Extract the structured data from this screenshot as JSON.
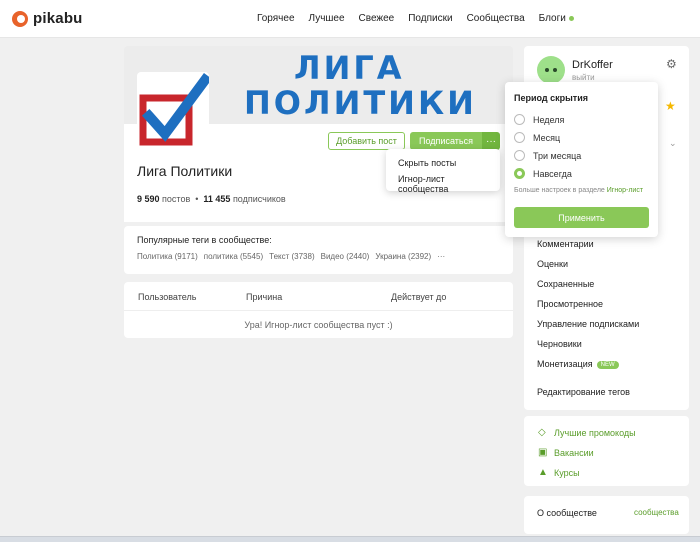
{
  "header": {
    "brand": "pikabu",
    "nav": [
      "Горячее",
      "Лучшее",
      "Свежее",
      "Подписки",
      "Сообщества",
      "Блоги"
    ]
  },
  "banner": {
    "line1": "ЛИГА",
    "line2": "ПОЛИТИКИ"
  },
  "community": {
    "title": "Лига Политики",
    "posts_count": "9 590",
    "posts_label": "постов",
    "subs_count": "11 455",
    "subs_label": "подписчиков",
    "add_post": "Добавить пост",
    "subscribe": "Подписаться",
    "more": "···"
  },
  "dropdown": {
    "items": [
      "Скрыть посты",
      "Игнор-лист сообщества"
    ]
  },
  "tags": {
    "title": "Популярные теги в сообществе:",
    "items": [
      "Политика (9171)",
      "политика (5545)",
      "Текст (3738)",
      "Видео (2440)",
      "Украина (2392)"
    ],
    "more": "···"
  },
  "table": {
    "headers": [
      "Пользователь",
      "Причина",
      "Действует до"
    ],
    "empty": "Ура! Игнор-лист сообщества пуст :)"
  },
  "user": {
    "name": "DrKoffer",
    "exit": "выйти",
    "menu": [
      "Комментарии",
      "Оценки",
      "Сохраненные",
      "Просмотренное",
      "Управление подписками",
      "Черновики",
      "Монетизация"
    ],
    "new_badge": "NEW",
    "edit_tags": "Редактирование тегов"
  },
  "promo": [
    "Лучшие промокоды",
    "Вакансии",
    "Курсы"
  ],
  "about": {
    "label": "О сообществе",
    "link": "сообщества"
  },
  "popup": {
    "title": "Период скрытия",
    "options": [
      "Неделя",
      "Месяц",
      "Три месяца",
      "Навсегда"
    ],
    "selected": "Навсегда",
    "hint_prefix": "Больше настроек в разделе ",
    "hint_link": "Игнор-лист",
    "apply": "Применить"
  },
  "colors": {
    "accent": "#8ac858",
    "brand": "#e8632b",
    "banner_text": "#1e6fc0"
  }
}
